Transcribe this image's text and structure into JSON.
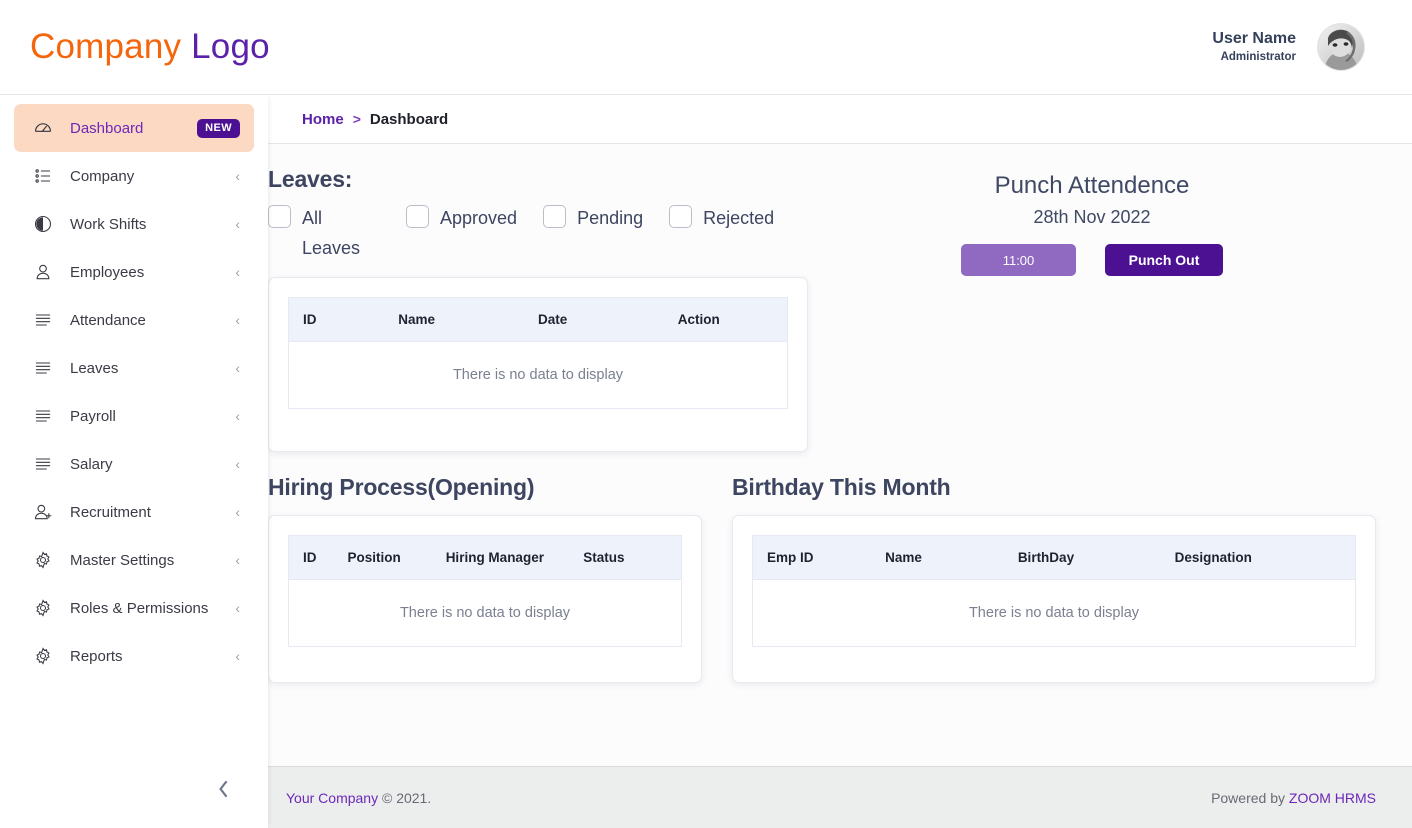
{
  "brand": {
    "logo_part1": "Company",
    "logo_part2": "Logo",
    "color_orange": "#f4650c",
    "color_purple": "#5b21a8"
  },
  "header": {
    "user_name": "User Name",
    "user_role": "Administrator",
    "avatar_icon": "user-avatar-photo"
  },
  "sidebar": {
    "items": [
      {
        "label": "Dashboard",
        "icon": "speedometer-icon",
        "active": true,
        "badge": "NEW",
        "chevron": ""
      },
      {
        "label": "Company",
        "icon": "list-bullets-icon",
        "active": false,
        "badge": "",
        "chevron": "‹"
      },
      {
        "label": "Work Shifts",
        "icon": "clock-pie-icon",
        "active": false,
        "badge": "",
        "chevron": "‹"
      },
      {
        "label": "Employees",
        "icon": "person-icon",
        "active": false,
        "badge": "",
        "chevron": "‹"
      },
      {
        "label": "Attendance",
        "icon": "lines-icon",
        "active": false,
        "badge": "",
        "chevron": "‹"
      },
      {
        "label": "Leaves",
        "icon": "lines-icon",
        "active": false,
        "badge": "",
        "chevron": "‹"
      },
      {
        "label": "Payroll",
        "icon": "lines-icon",
        "active": false,
        "badge": "",
        "chevron": "‹"
      },
      {
        "label": "Salary",
        "icon": "lines-icon",
        "active": false,
        "badge": "",
        "chevron": "‹"
      },
      {
        "label": "Recruitment",
        "icon": "person-plus-icon",
        "active": false,
        "badge": "",
        "chevron": "‹"
      },
      {
        "label": "Master Settings",
        "icon": "gear-icon",
        "active": false,
        "badge": "",
        "chevron": "‹"
      },
      {
        "label": "Roles & Permissions",
        "icon": "gear-icon",
        "active": false,
        "badge": "",
        "chevron": "‹"
      },
      {
        "label": "Reports",
        "icon": "gear-icon",
        "active": false,
        "badge": "",
        "chevron": "‹"
      }
    ],
    "collapse_icon": "chevron-left-icon"
  },
  "breadcrumb": {
    "home": "Home",
    "separator": ">",
    "current": "Dashboard"
  },
  "leaves": {
    "title": "Leaves:",
    "filters": [
      {
        "label": "All Leaves",
        "checked": false
      },
      {
        "label": "Approved",
        "checked": false
      },
      {
        "label": "Pending",
        "checked": false
      },
      {
        "label": "Rejected",
        "checked": false
      }
    ],
    "table": {
      "columns": [
        "ID",
        "Name",
        "Date",
        "Action"
      ],
      "rows": [],
      "empty_text": "There is no data to display"
    }
  },
  "punch": {
    "title": "Punch Attendence",
    "date": "28th Nov 2022",
    "time_value": "11:00",
    "action_label": "Punch Out",
    "time_color": "#9069c0",
    "action_color": "#4c1193"
  },
  "hiring": {
    "title": "Hiring Process(Opening)",
    "table": {
      "columns": [
        "ID",
        "Position",
        "Hiring Manager",
        "Status"
      ],
      "rows": [],
      "empty_text": "There is no data to display"
    }
  },
  "birthday": {
    "title": "Birthday This Month",
    "table": {
      "columns": [
        "Emp ID",
        "Name",
        "BirthDay",
        "Designation"
      ],
      "rows": [],
      "empty_text": "There is no data to display"
    }
  },
  "footer": {
    "company_link": "Your Company",
    "copyright": "© 2021.",
    "powered_prefix": "Powered by ",
    "powered_link": "ZOOM HRMS"
  }
}
